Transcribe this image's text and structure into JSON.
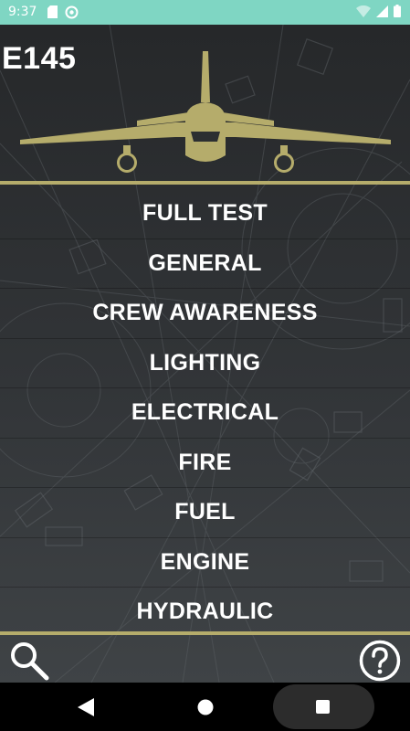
{
  "status_bar": {
    "time": "9:37",
    "icons": [
      "sd-card-icon",
      "sync-icon",
      "wifi-icon",
      "signal-icon",
      "battery-icon"
    ]
  },
  "app": {
    "title": "E145",
    "accent_color": "#b5ac6b",
    "menu": [
      {
        "label": "FULL TEST"
      },
      {
        "label": "GENERAL"
      },
      {
        "label": "CREW AWARENESS"
      },
      {
        "label": "LIGHTING"
      },
      {
        "label": "ELECTRICAL"
      },
      {
        "label": "FIRE"
      },
      {
        "label": "FUEL"
      },
      {
        "label": "ENGINE"
      },
      {
        "label": "HYDRAULIC"
      }
    ],
    "bottom_icons": [
      "search-icon",
      "help-icon"
    ]
  },
  "nav_bar": {
    "buttons": [
      "back-icon",
      "home-icon",
      "recents-icon"
    ]
  }
}
